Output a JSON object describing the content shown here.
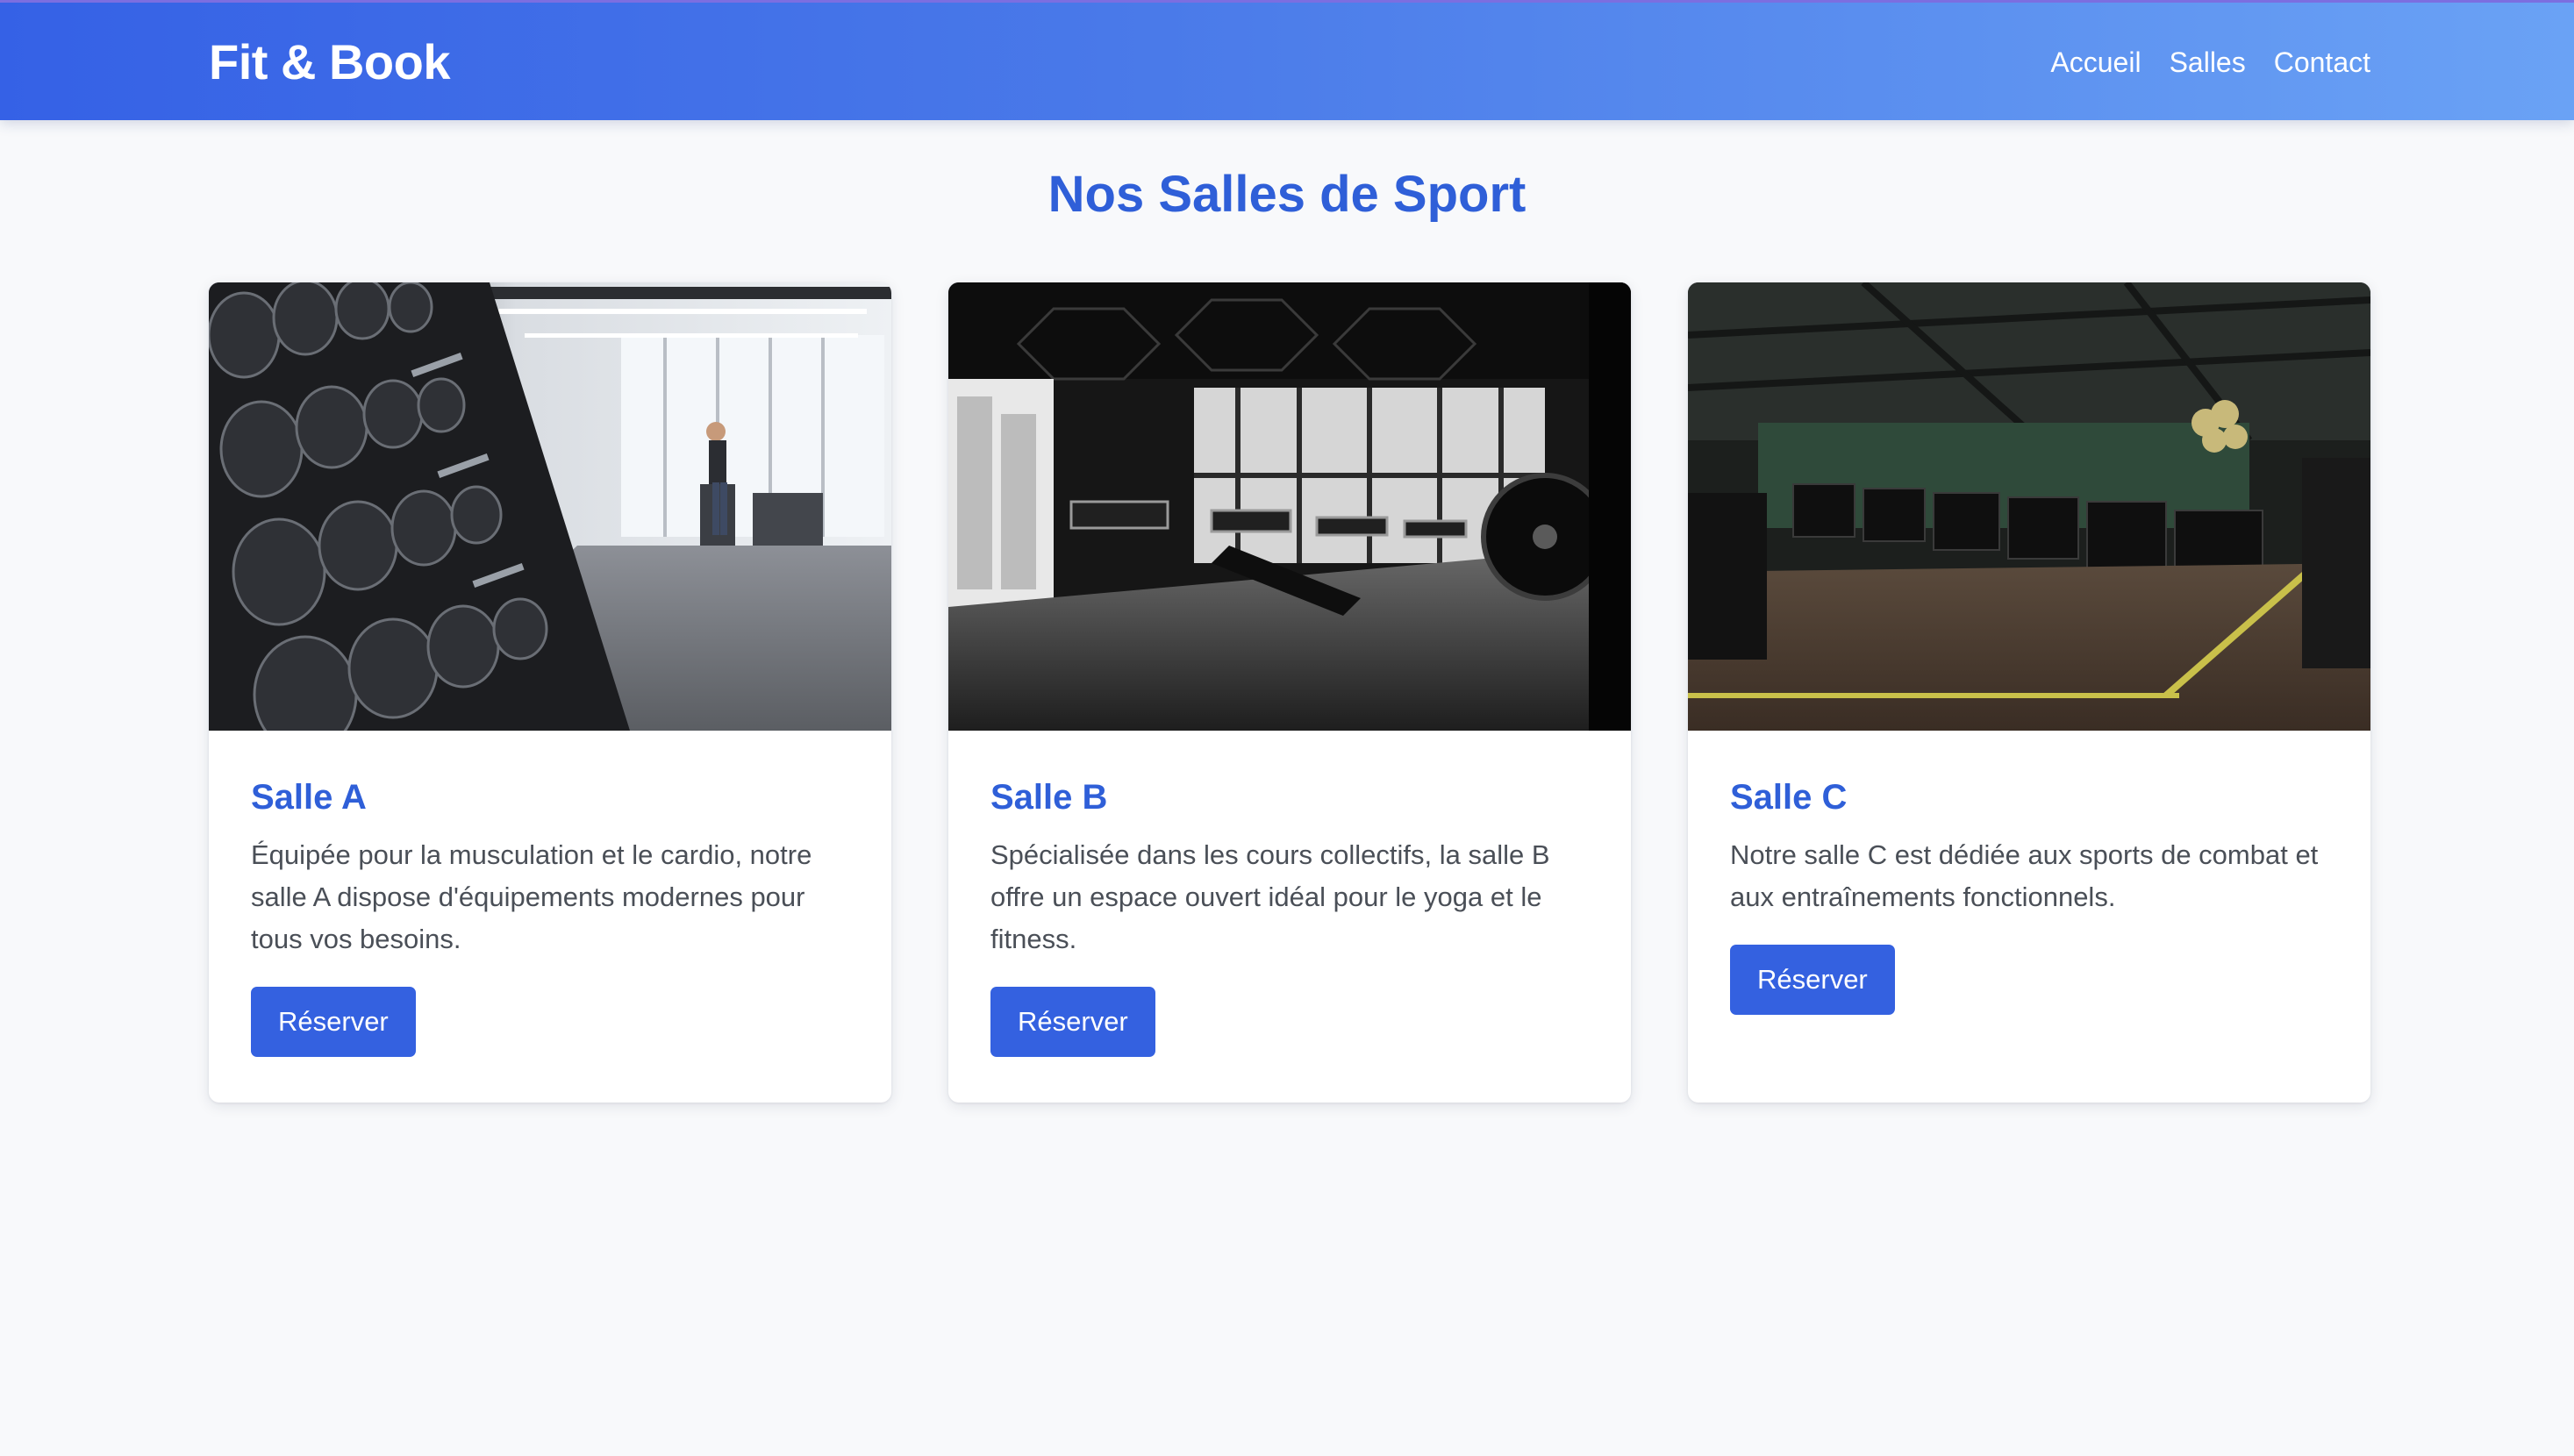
{
  "header": {
    "logo": "Fit & Book",
    "nav": [
      "Accueil",
      "Salles",
      "Contact"
    ]
  },
  "page_title": "Nos Salles de Sport",
  "cards": [
    {
      "title": "Salle A",
      "description": "Équipée pour la musculation et le cardio, notre salle A dispose d'équipements modernes pour tous vos besoins.",
      "button": "Réserver",
      "image": "gym-dumbbell-rack-photo"
    },
    {
      "title": "Salle B",
      "description": "Spécialisée dans les cours collectifs, la salle B offre un espace ouvert idéal pour le yoga et le fitness.",
      "button": "Réserver",
      "image": "gym-black-and-white-treadmills-photo"
    },
    {
      "title": "Salle C",
      "description": "Notre salle C est dédiée aux sports de combat et aux entraînements fonctionnels.",
      "button": "Réserver",
      "image": "dark-gym-treadmills-photo"
    }
  ],
  "colors": {
    "accent": "#2f5fd8",
    "button": "#3461e0",
    "header_start": "#3561e6",
    "header_end": "#6aa2f5",
    "background": "#f8f9fb"
  }
}
